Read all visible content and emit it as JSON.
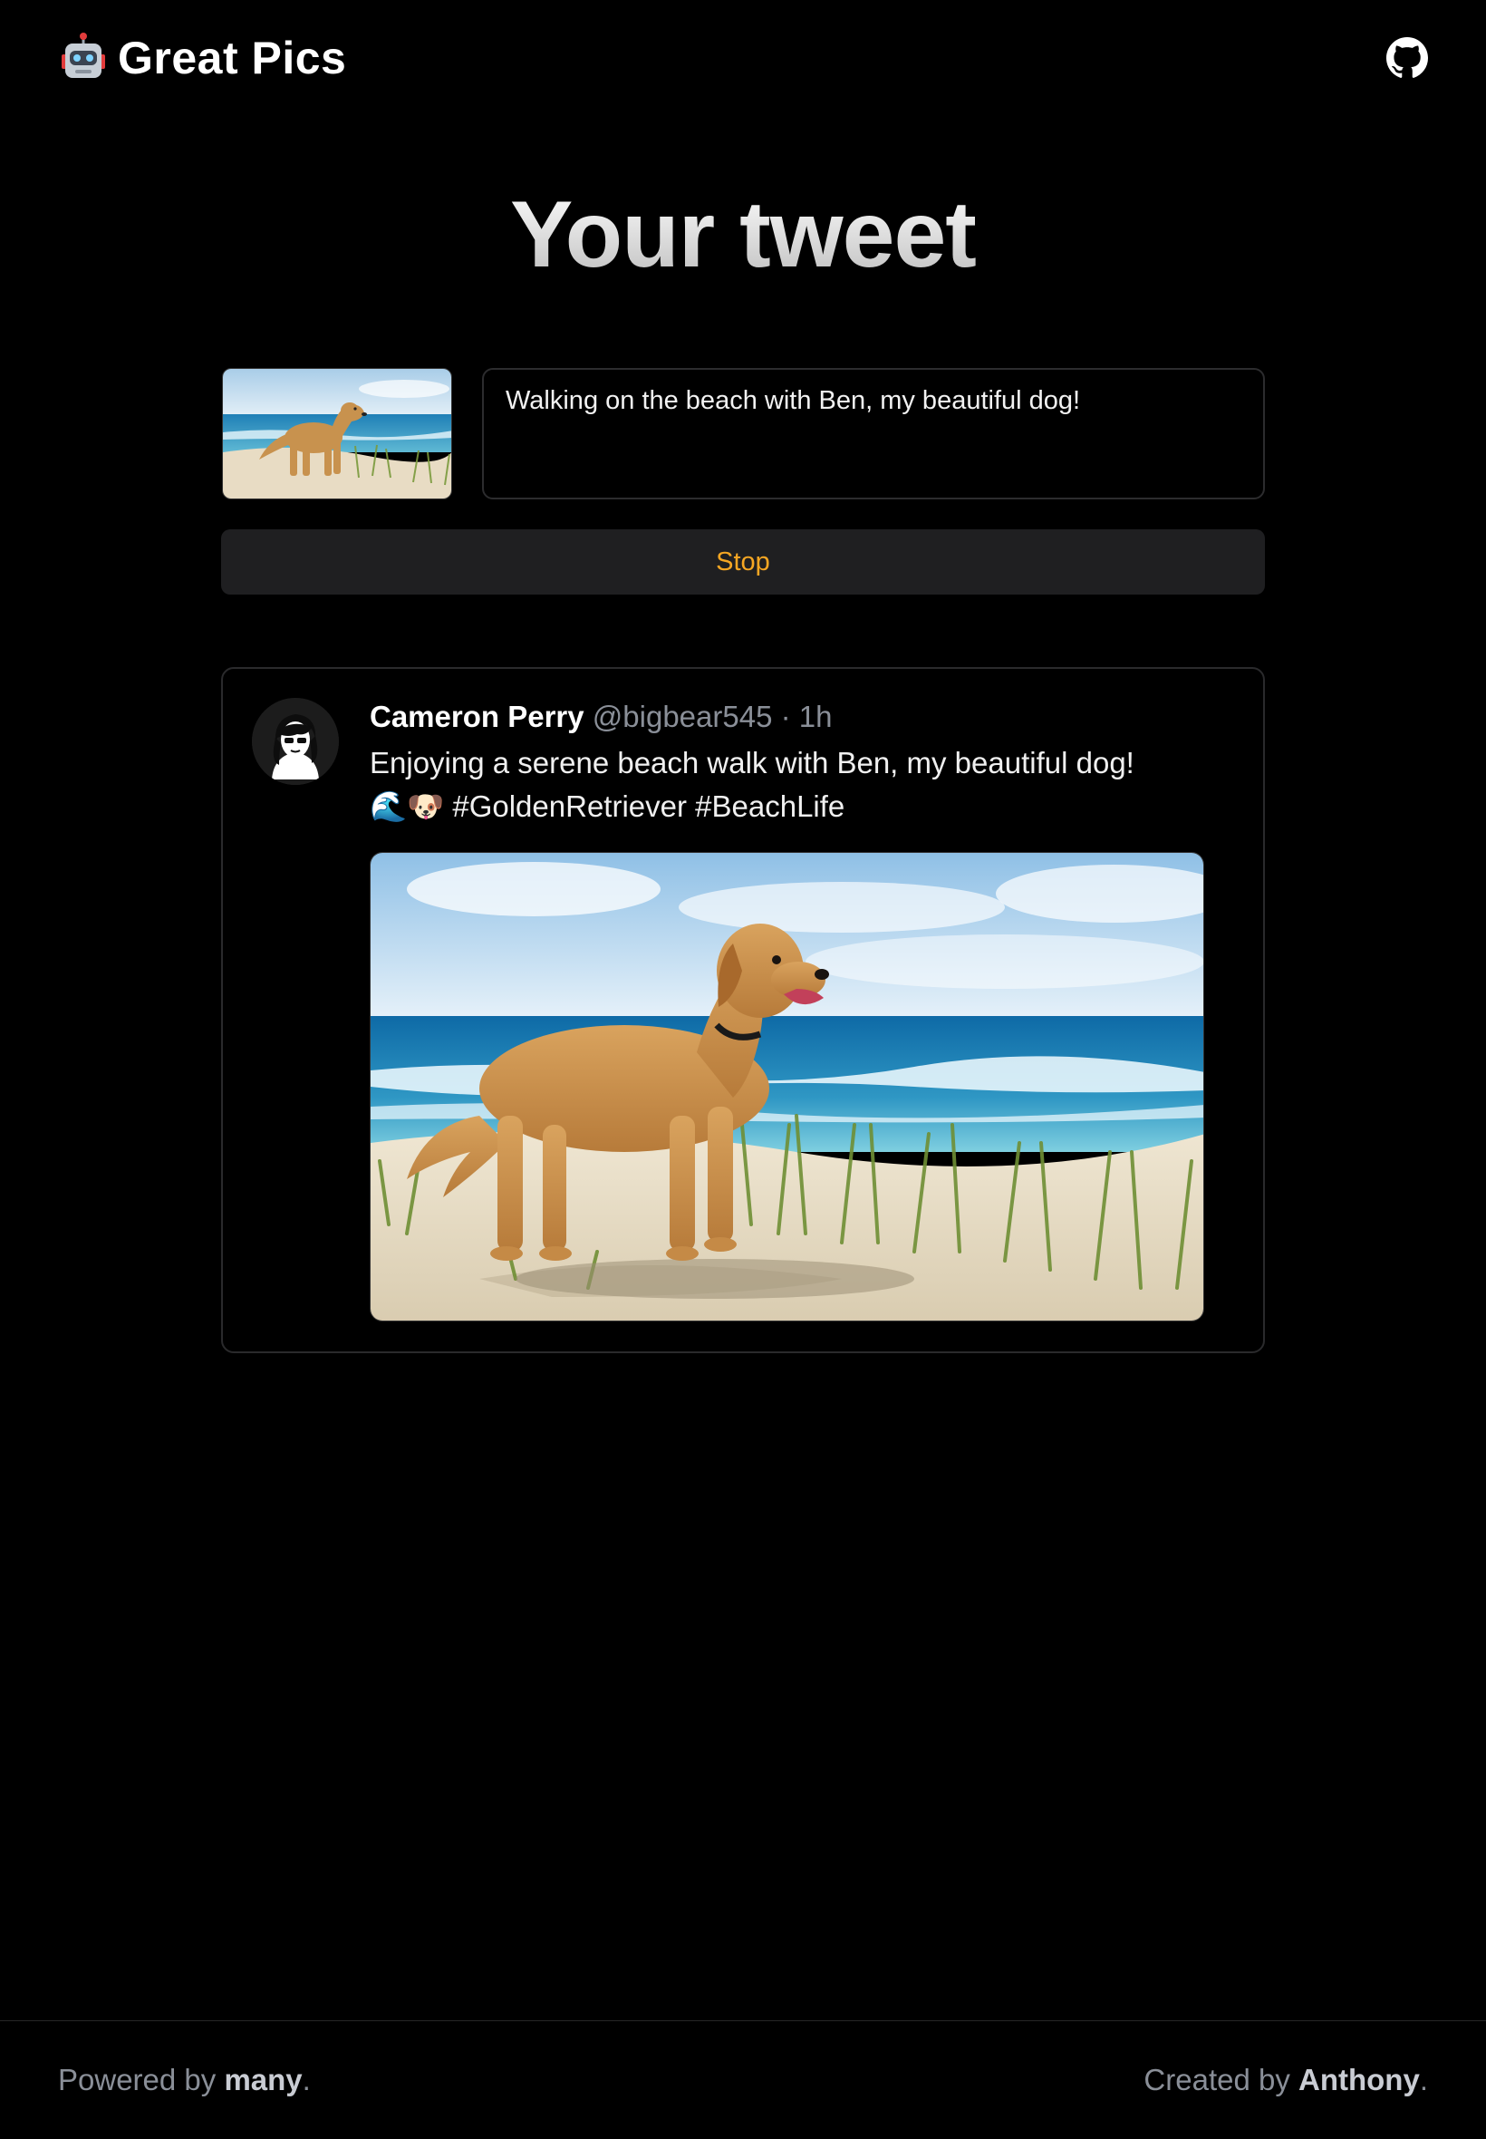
{
  "header": {
    "brand_icon": "robot-icon",
    "brand_name": "Great Pics",
    "github_icon": "github-icon"
  },
  "main": {
    "title": "Your tweet",
    "composer": {
      "thumbnail": "golden retriever on beach dunes",
      "input_value": "Walking on the beach with Ben, my beautiful dog!",
      "stop_label": "Stop",
      "stop_color": "#f5a623"
    },
    "tweet": {
      "name": "Cameron Perry",
      "handle": "@bigbear545",
      "separator": "·",
      "time": "1h",
      "text": "Enjoying a serene beach walk with Ben, my beautiful dog! 🌊🐶 #GoldenRetriever #BeachLife",
      "avatar_icon": "avatar-icon",
      "image": "golden retriever standing on sandy beach dunes with ocean behind"
    }
  },
  "footer": {
    "powered_prefix": "Powered by ",
    "powered_link": "many",
    "powered_suffix": ".",
    "created_prefix": "Created by ",
    "created_link": "Anthony",
    "created_suffix": "."
  }
}
